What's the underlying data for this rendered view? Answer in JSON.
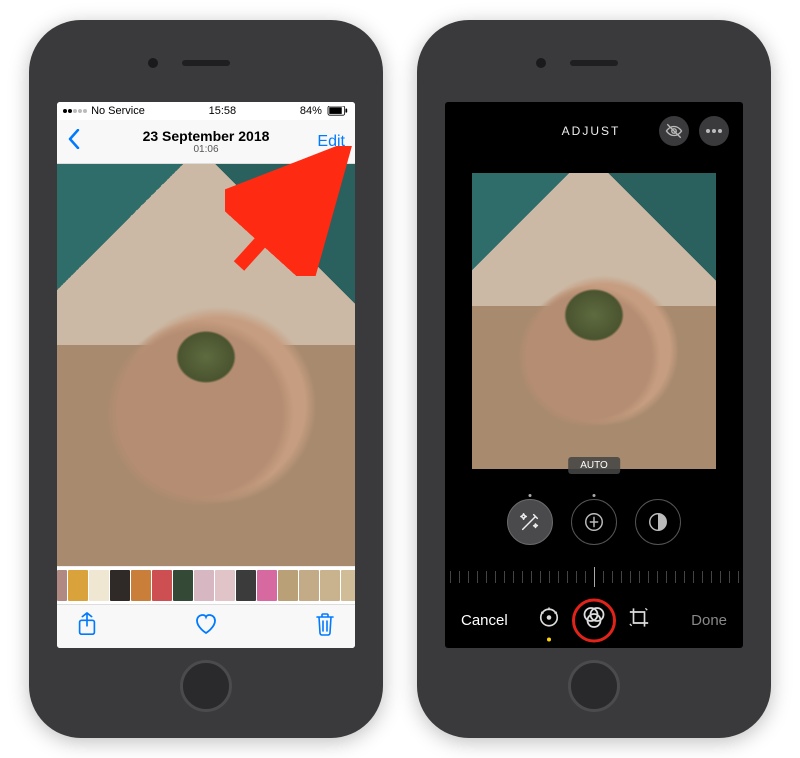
{
  "left": {
    "status": {
      "carrier": "No Service",
      "time": "15:58",
      "battery": "84%"
    },
    "navbar": {
      "title": "23 September 2018",
      "subtitle": "01:06",
      "edit": "Edit"
    },
    "thumbs": [
      "#7a3b2e",
      "#d9a23a",
      "#efe7d2",
      "#2f2a27",
      "#c97f3a",
      "#ce4f52",
      "#354a36",
      "#d7b7c1",
      "#e0c4c8",
      "#3b3b3b",
      "#d66aa0",
      "#baa077",
      "#c2ab86",
      "#c9b38f",
      "#d1bc98",
      "#c7af84"
    ],
    "toolbar_icons": {
      "share": "share-icon",
      "like": "heart-icon",
      "trash": "trash-icon"
    }
  },
  "right": {
    "header": {
      "title": "ADJUST"
    },
    "auto_label": "AUTO",
    "adjust_buttons": [
      {
        "name": "auto-adjust",
        "active": true
      },
      {
        "name": "exposure",
        "active": false
      },
      {
        "name": "brilliance",
        "active": false
      }
    ],
    "bottom": {
      "cancel": "Cancel",
      "done": "Done",
      "modes": [
        {
          "name": "adjust-mode",
          "active": true
        },
        {
          "name": "filters-mode",
          "active": false
        },
        {
          "name": "crop-mode",
          "active": false
        }
      ]
    }
  }
}
